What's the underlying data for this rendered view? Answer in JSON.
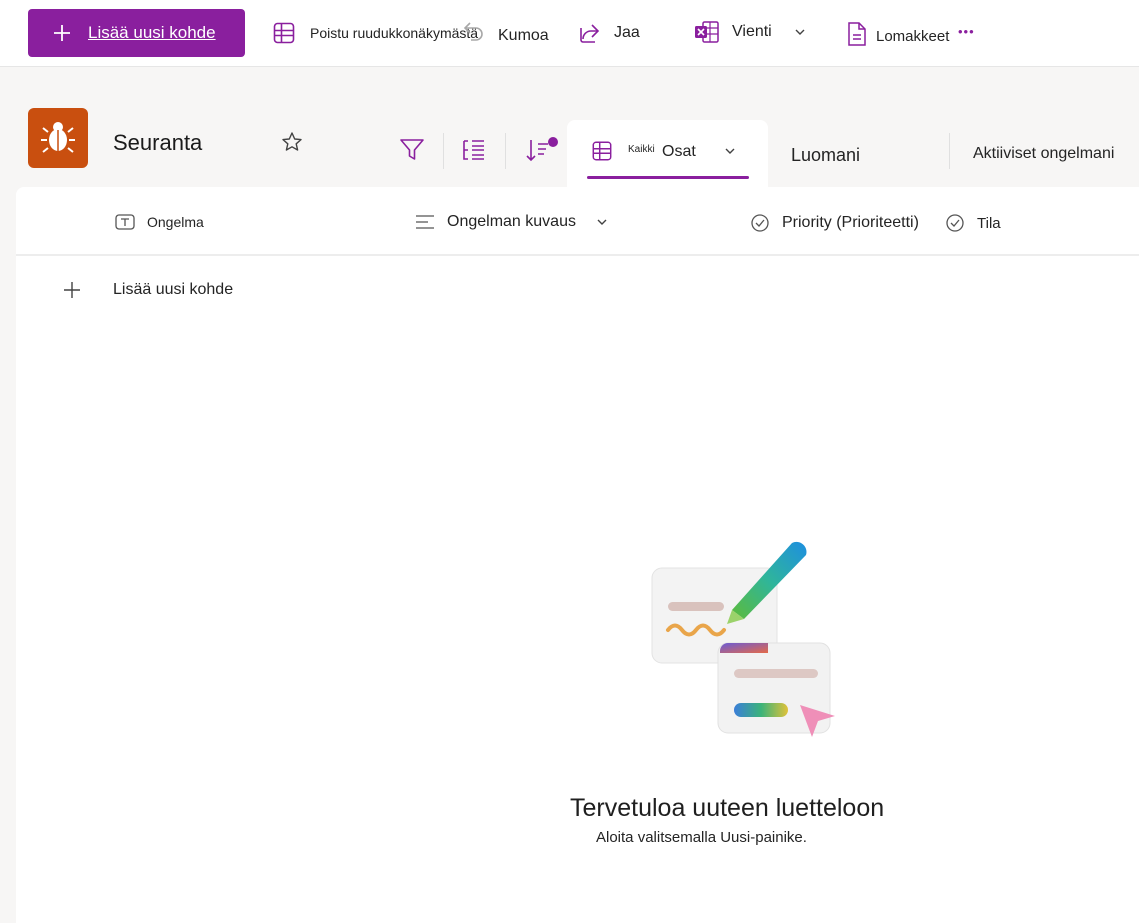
{
  "command_bar": {
    "new_item": "Lisää uusi kohde",
    "exit_grid": "Poistu ruudukkonäkymästä",
    "undo": "Kumoa",
    "share": "Jaa",
    "export": "Vienti",
    "forms": "Lomakkeet",
    "more": "•••"
  },
  "list": {
    "title": "Seuranta"
  },
  "views": {
    "current_prefix": "Kaikki",
    "current": "Osat",
    "tab_mine": "Luomani",
    "tab_active": "Aktiiviset ongelmani"
  },
  "columns": [
    {
      "label": "Ongelma",
      "icon": "text-icon"
    },
    {
      "label": "Ongelman kuvaus",
      "icon": "multiline-text-icon"
    },
    {
      "label": "Priority (Prioriteetti)",
      "icon": "choice-icon"
    },
    {
      "label": "Tila",
      "icon": "choice-icon"
    }
  ],
  "add_row": "Lisää uusi kohde",
  "empty_state": {
    "title": "Tervetuloa uuteen luetteloon",
    "subtitle": "Aloita valitsemalla Uusi-painike."
  },
  "colors": {
    "accent": "#8a1f9e",
    "app_icon": "#c94f0f",
    "sort_badge": "#8a1f9e"
  }
}
